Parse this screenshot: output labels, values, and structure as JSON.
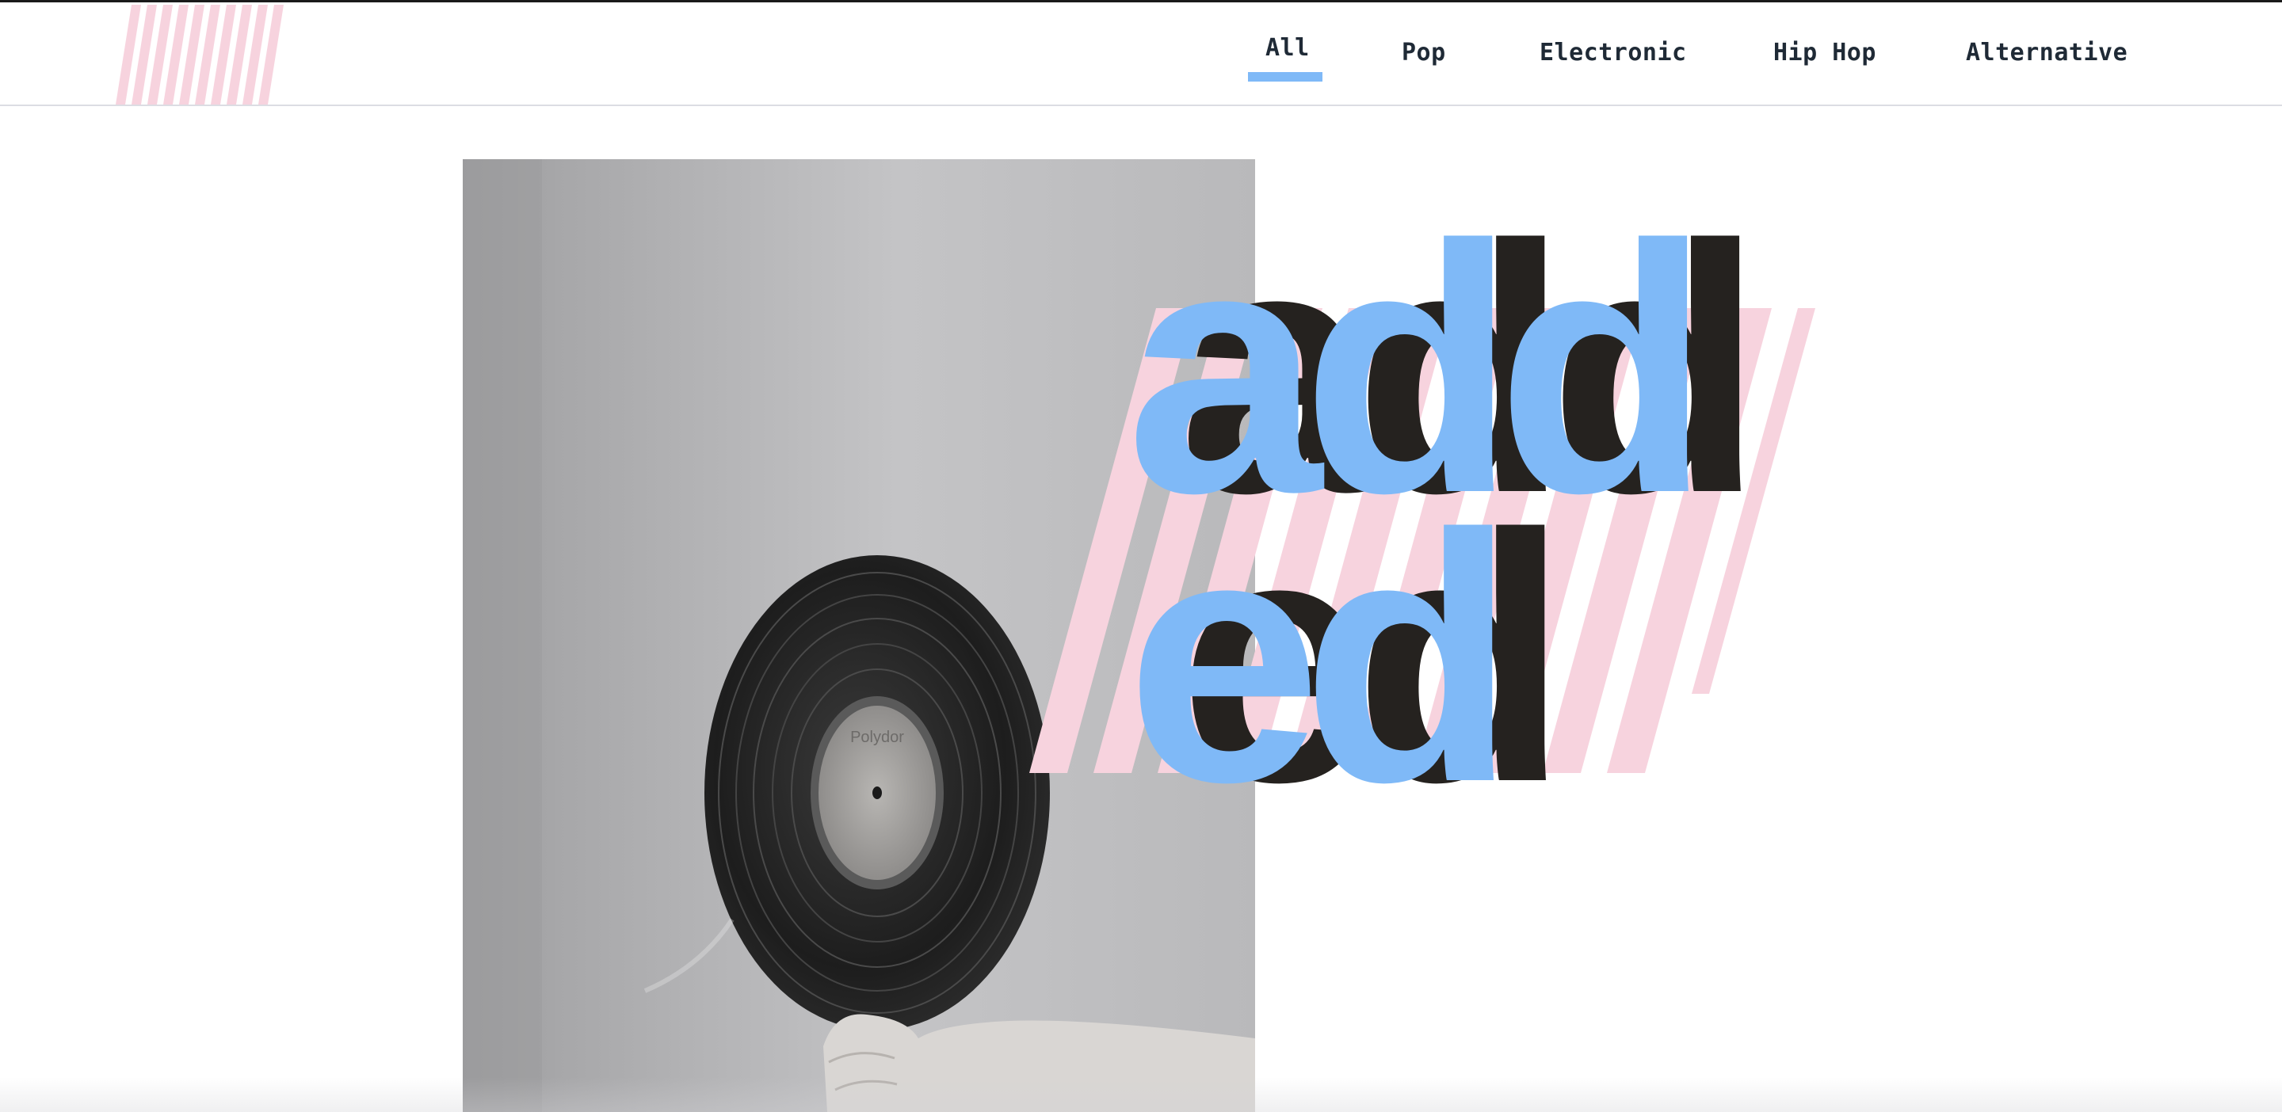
{
  "brand": {
    "logo_icon": "diagonal-stripes-logo",
    "stripe_color": "#f7d3de"
  },
  "nav": {
    "items": [
      {
        "label": "All",
        "active": true
      },
      {
        "label": "Pop",
        "active": false
      },
      {
        "label": "Electronic",
        "active": false
      },
      {
        "label": "Hip Hop",
        "active": false
      },
      {
        "label": "Alternative",
        "active": false
      }
    ],
    "active_color": "#7fb9f7",
    "text_color": "#1f2a36"
  },
  "hero": {
    "word_line1": "add",
    "word_line2": "ed",
    "word_color": "#7fb9f7",
    "shadow_color": "#25221f",
    "stripe_color": "#f7d3de",
    "image_subject": "vinyl-record-photo",
    "record_label_text": "Polydor"
  }
}
